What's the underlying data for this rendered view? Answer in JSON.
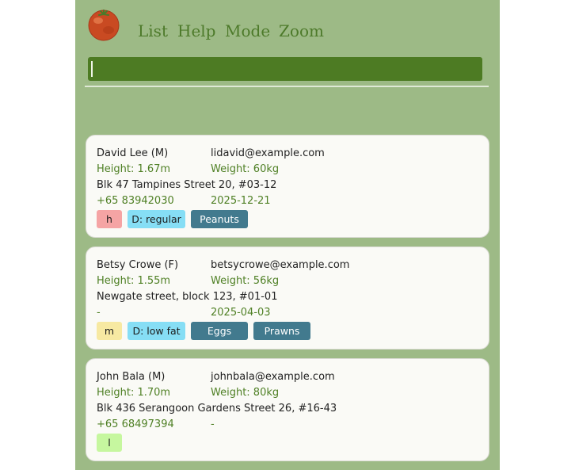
{
  "menu": {
    "list": "List",
    "help": "Help",
    "mode": "Mode",
    "zoom": "Zoom"
  },
  "command": {
    "value": ""
  },
  "patients": [
    {
      "name": "David Lee (M)",
      "email": "lidavid@example.com",
      "height": "Height: 1.67m",
      "weight": "Weight: 60kg",
      "address": "Blk 47 Tampines Street 20, #03-12",
      "phone": "+65 83942030",
      "date": "2025-12-21",
      "priority": "h",
      "diet": "D: regular",
      "allergies": [
        "Peanuts"
      ]
    },
    {
      "name": "Betsy Crowe (F)",
      "email": "betsycrowe@example.com",
      "height": "Height: 1.55m",
      "weight": "Weight: 56kg",
      "address": "Newgate street, block 123, #01-01",
      "phone": "-",
      "date": "2025-04-03",
      "priority": "m",
      "diet": "D: low fat",
      "allergies": [
        "Eggs",
        "Prawns"
      ]
    },
    {
      "name": "John Bala (M)",
      "email": "johnbala@example.com",
      "height": "Height: 1.70m",
      "weight": "Weight: 80kg",
      "address": "Blk 436 Serangoon Gardens Street 26, #16-43",
      "phone": "+65 68497394",
      "date": "-",
      "priority": "l"
    }
  ]
}
